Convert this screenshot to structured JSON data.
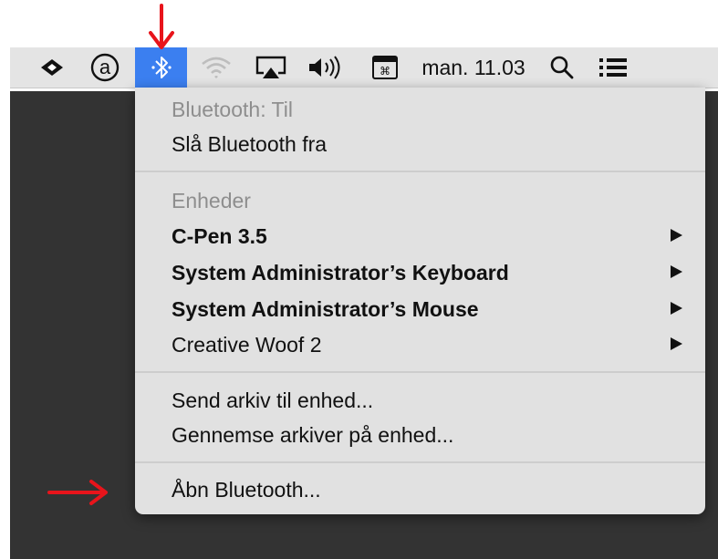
{
  "menubar": {
    "items": [
      {
        "icon": "dropbox-icon"
      },
      {
        "icon": "at-sign-icon"
      },
      {
        "icon": "bluetooth-icon"
      },
      {
        "icon": "wifi-icon"
      },
      {
        "icon": "airplay-icon"
      },
      {
        "icon": "volume-icon"
      },
      {
        "icon": "input-menu-icon"
      }
    ],
    "clock": "man. 11.03",
    "search_icon": "search-icon",
    "notification_icon": "notification-center-icon",
    "highlight_color": "#3b7ff0"
  },
  "bluetooth_menu": {
    "status": "Bluetooth: Til",
    "toggle": "Slå Bluetooth fra",
    "devices_header": "Enheder",
    "devices": [
      {
        "name": "C-Pen 3.5"
      },
      {
        "name": "System Administrator’s Keyboard"
      },
      {
        "name": "System Administrator’s Mouse"
      },
      {
        "name": "Creative Woof 2"
      }
    ],
    "send_file": "Send arkiv til enhed...",
    "browse_files": "Gennemse arkiver på enhed...",
    "open_prefs": "Åbn Bluetooth..."
  },
  "annotations": {
    "arrow_color": "#e8141b"
  }
}
